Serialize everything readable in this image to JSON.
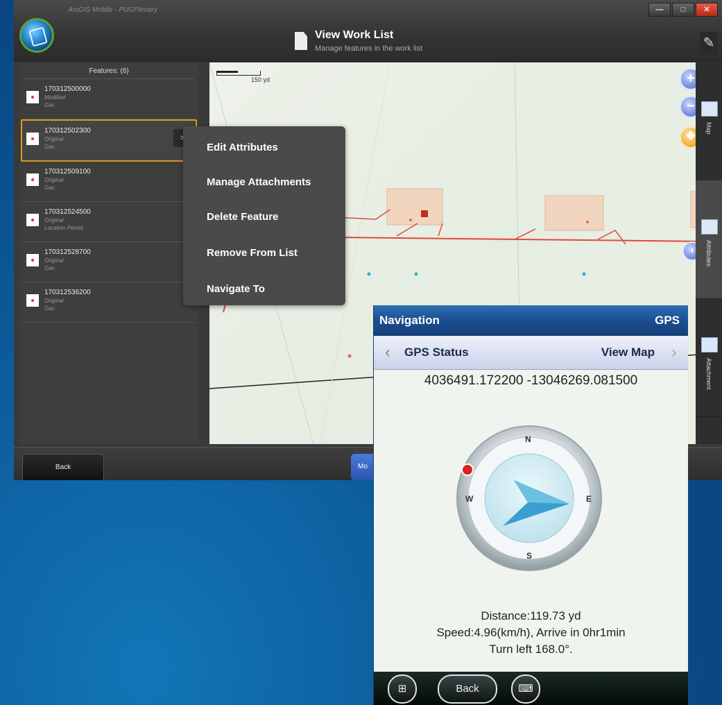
{
  "app": {
    "name": "ArcGIS Mobile - PUGPlenary",
    "page_title": "View Work List",
    "page_subtitle": "Manage features in the work list",
    "window_controls": {
      "minimize": "—",
      "maximize": "□",
      "close": "✕"
    }
  },
  "features_panel": {
    "header": "Features: (6)",
    "items": [
      {
        "id": "170312500000",
        "status": "Modified",
        "type": "Gas"
      },
      {
        "id": "170312502300",
        "status": "Original",
        "type": "Gas"
      },
      {
        "id": "170312509100",
        "status": "Original",
        "type": "Gas"
      },
      {
        "id": "170312524500",
        "status": "Original",
        "type": "Location Permit"
      },
      {
        "id": "170312528700",
        "status": "Original",
        "type": "Gas"
      },
      {
        "id": "170312536200",
        "status": "Original",
        "type": "Gas"
      }
    ],
    "selected_arrow": ">"
  },
  "context_menu": {
    "items": [
      "Edit Attributes",
      "Manage Attachments",
      "Delete Feature",
      "Remove From List",
      "Navigate To"
    ]
  },
  "map": {
    "scale_label": "150 yd",
    "zoom_in": "+",
    "zoom_out": "−",
    "collapse": "‹"
  },
  "side_tabs": [
    "Map",
    "Attributes",
    "Attachment"
  ],
  "bottom_bar": {
    "back": "Back",
    "more": "Mo"
  },
  "navigation": {
    "title": "Navigation",
    "right_label": "GPS",
    "tab_left": "GPS Status",
    "tab_right": "View Map",
    "coords": "4036491.172200 -13046269.081500",
    "compass": {
      "n": "N",
      "s": "S",
      "w": "W",
      "e": "E",
      "heading_deg": 168.0
    },
    "distance": "Distance:119.73 yd",
    "speed": "Speed:4.96(km/h), Arrive in 0hr1min",
    "turn": "Turn left 168.0°.",
    "back_button": "Back"
  },
  "colors": {
    "accent_selected": "#d89a1e",
    "route_line": "#e04a3a",
    "nav_header": "#1c4e90",
    "compass_arrow": "#3a9fd0"
  }
}
